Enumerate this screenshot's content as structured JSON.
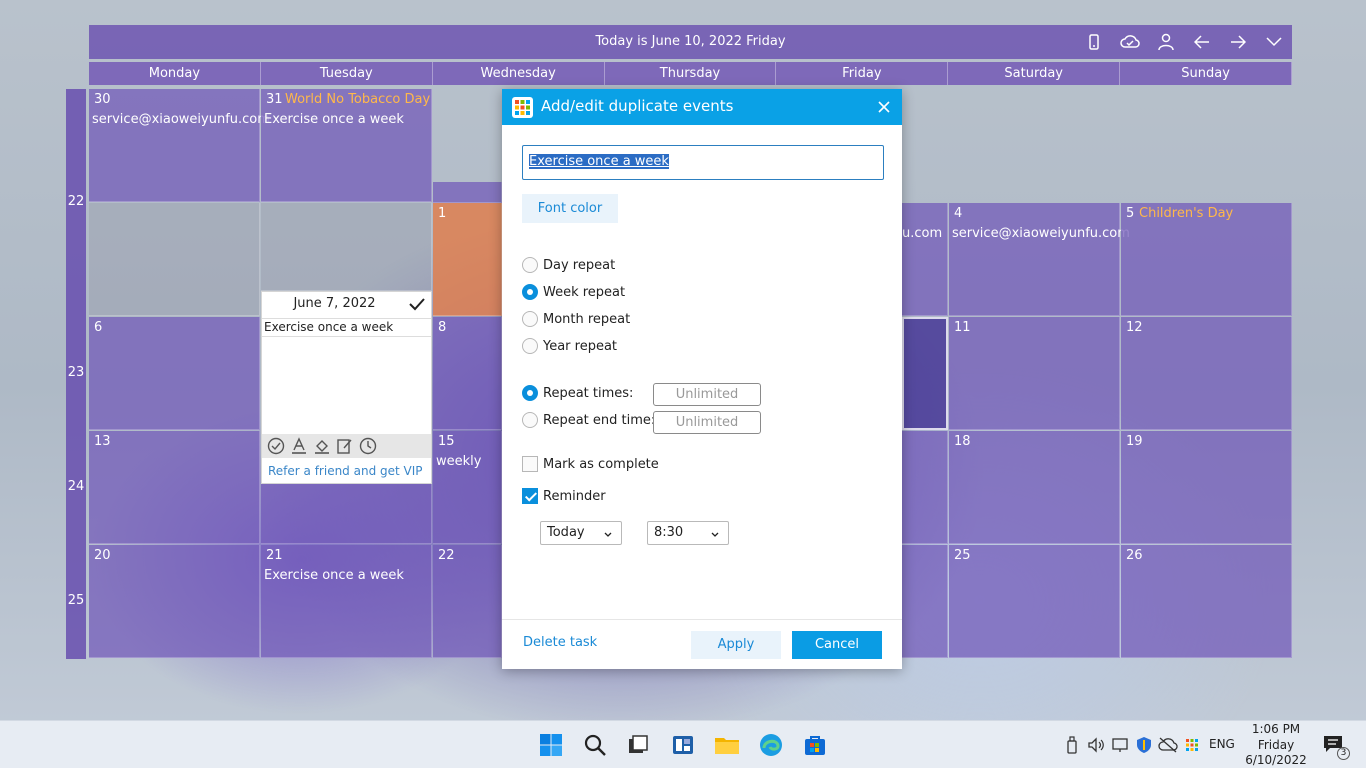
{
  "calendar": {
    "today_label": "Today is June 10, 2022 Friday",
    "weekdays": [
      "Monday",
      "Tuesday",
      "Wednesday",
      "Thursday",
      "Friday",
      "Saturday",
      "Sunday"
    ],
    "week_numbers": [
      "22",
      "23",
      "24",
      "25"
    ],
    "cells": {
      "may30": {
        "day": "30",
        "event": "service@xiaoweiyunfu.com"
      },
      "may31": {
        "day": "31",
        "holiday": "World No Tobacco Day",
        "event": "Exercise once a week"
      },
      "jun1": {
        "day": "1"
      },
      "jun3_partial": {
        "event": "u.com"
      },
      "jun4": {
        "day": "4",
        "event": "service@xiaoweiyunfu.com"
      },
      "jun5": {
        "day": "5",
        "holiday": "Children's Day"
      },
      "jun6": {
        "day": "6"
      },
      "jun8": {
        "day": "8"
      },
      "jun11": {
        "day": "11"
      },
      "jun12": {
        "day": "12"
      },
      "jun13": {
        "day": "13"
      },
      "jun15": {
        "day": "15",
        "event": "weekly"
      },
      "jun18": {
        "day": "18"
      },
      "jun19": {
        "day": "19"
      },
      "jun20": {
        "day": "20"
      },
      "jun21": {
        "day": "21",
        "event": "Exercise once a week"
      },
      "jun22": {
        "day": "22"
      },
      "jun25": {
        "day": "25"
      },
      "jun26": {
        "day": "26"
      }
    },
    "toolbar_icons": [
      "phone-icon",
      "cloud-sync-icon",
      "user-icon",
      "arrow-left-icon",
      "arrow-right-icon",
      "chevron-down-icon"
    ]
  },
  "note_popup": {
    "date": "June 7, 2022",
    "text": "Exercise once a week",
    "link": "Refer a friend and get VIP"
  },
  "dialog": {
    "title": "Add/edit duplicate events",
    "event_title": "Exercise once a week",
    "font_color_label": "Font color",
    "repeat_options": [
      "Day repeat",
      "Week repeat",
      "Month repeat",
      "Year repeat"
    ],
    "selected_repeat": "Week repeat",
    "repeat_times_label": "Repeat times:",
    "repeat_times_value": "Unlimited",
    "repeat_end_label": "Repeat end time:",
    "repeat_end_value": "Unlimited",
    "mark_complete_label": "Mark as complete",
    "mark_complete_checked": false,
    "reminder_label": "Reminder",
    "reminder_checked": true,
    "reminder_day": "Today",
    "reminder_time": "8:30",
    "delete_label": "Delete task",
    "apply_label": "Apply",
    "cancel_label": "Cancel",
    "accent_color": "#0aa1e6"
  },
  "taskbar": {
    "language": "ENG",
    "time": "1:06 PM",
    "day": "Friday",
    "date": "6/10/2022",
    "notification_count": "3"
  }
}
